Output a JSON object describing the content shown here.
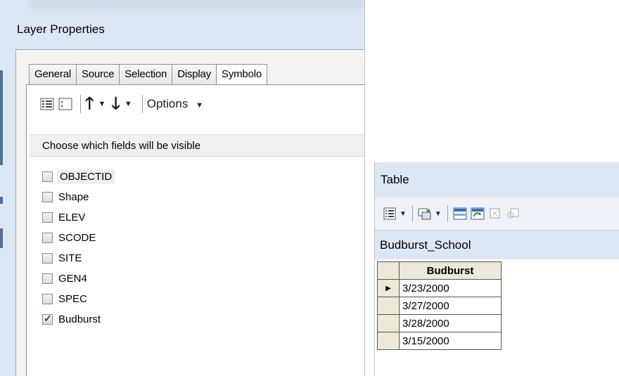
{
  "layer_properties": {
    "title": "Layer Properties",
    "tabs": [
      "General",
      "Source",
      "Selection",
      "Display",
      "Symbolo"
    ],
    "toolbar": {
      "options_label": "Options"
    },
    "choose_text": "Choose which fields will be visible",
    "fields": [
      {
        "name": "OBJECTID",
        "checked": false
      },
      {
        "name": "Shape",
        "checked": false
      },
      {
        "name": "ELEV",
        "checked": false
      },
      {
        "name": "SCODE",
        "checked": false
      },
      {
        "name": "SITE",
        "checked": false
      },
      {
        "name": "GEN4",
        "checked": false
      },
      {
        "name": "SPEC",
        "checked": false
      },
      {
        "name": "Budburst",
        "checked": true
      }
    ]
  },
  "table_window": {
    "title": "Table",
    "table_name": "Budburst_School",
    "column_header": "Budburst",
    "rows": [
      "3/23/2000",
      "3/27/2000",
      "3/28/2000",
      "3/15/2000"
    ],
    "current_row_marker": "▶"
  },
  "colors": {
    "window_bg": "#dde7f3",
    "check_color": "#1f3f78"
  }
}
